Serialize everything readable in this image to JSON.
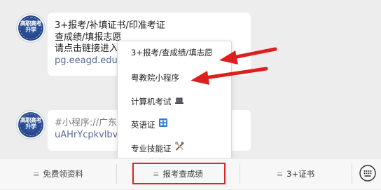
{
  "avatar": {
    "text_line1": "高职高考",
    "text_line2": "升学"
  },
  "message1": {
    "line1": "3+报考/补填证书/印准考证",
    "line2": "查成绩/填报志愿",
    "line3": "请点击链接进入",
    "link": "pg.eeagd.edu"
  },
  "message2": {
    "line1": "#小程序://广东",
    "line2": "uAHrYcpkvlbv"
  },
  "menu": {
    "items": [
      {
        "label": "3+报考/查成绩/填志愿"
      },
      {
        "label": "粤教院小程序"
      },
      {
        "label": "计算机考试",
        "icon": "laptop-icon"
      },
      {
        "label": "英语证",
        "icon": "english-badge-icon"
      },
      {
        "label": "专业技能证",
        "icon": "tools-icon"
      }
    ]
  },
  "tabs": [
    {
      "label": "免费领资料",
      "icon": "menu-lines-icon"
    },
    {
      "label": "报考查成绩",
      "icon": "menu-lines-icon"
    },
    {
      "label": "3+证书",
      "icon": "menu-lines-icon"
    }
  ],
  "colors": {
    "accent_red": "#d92626",
    "link_blue": "#576b95",
    "background": "#ededed"
  }
}
